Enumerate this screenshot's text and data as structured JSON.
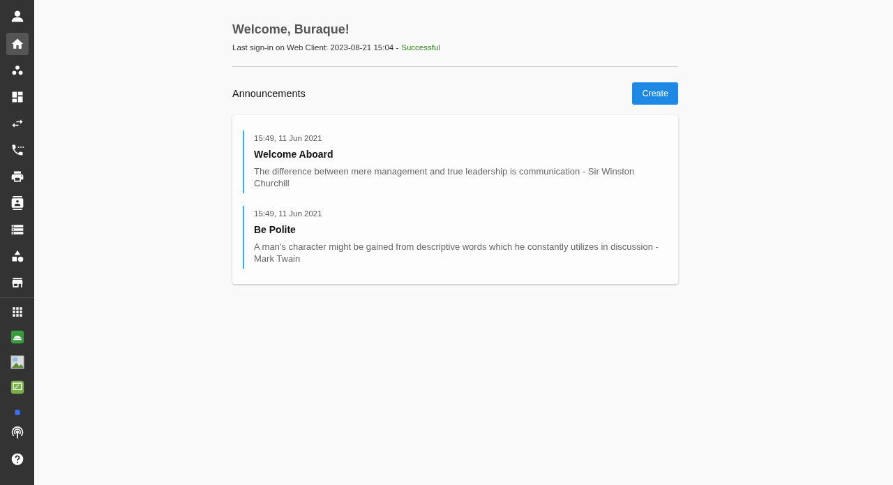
{
  "sidebar": {
    "top": [
      {
        "kind": "user",
        "selected": false
      }
    ],
    "upper": [
      {
        "kind": "home",
        "selected": true
      },
      {
        "kind": "groups",
        "selected": false
      },
      {
        "kind": "dashboard",
        "selected": false
      },
      {
        "kind": "swap",
        "selected": false
      },
      {
        "kind": "phone",
        "selected": false
      },
      {
        "kind": "printer",
        "selected": false
      },
      {
        "kind": "contact",
        "selected": false
      },
      {
        "kind": "list",
        "selected": false
      },
      {
        "kind": "shapes",
        "selected": false
      },
      {
        "kind": "store",
        "selected": false
      }
    ],
    "lower": [
      {
        "kind": "apps",
        "selected": false
      },
      {
        "kind": "tile-green",
        "selected": false
      },
      {
        "kind": "image",
        "selected": false
      },
      {
        "kind": "tile-picture",
        "selected": false
      },
      {
        "kind": "tile-blue",
        "selected": false
      }
    ],
    "bottom": [
      {
        "kind": "broadcast",
        "selected": false
      },
      {
        "kind": "help",
        "selected": false
      }
    ]
  },
  "welcome": {
    "title": "Welcome, Buraque!",
    "last_sign_in": "Last sign-in on Web Client: 2023-08-21 15:04 -",
    "status": "Successful"
  },
  "announcements": {
    "title": "Announcements",
    "create_button": "Create",
    "items": [
      {
        "time": "15:49, 11 Jun 2021",
        "title": "Welcome Aboard",
        "body": "The difference between mere management and true leadership is communication - Sir Winston Churchill"
      },
      {
        "time": "15:49, 11 Jun 2021",
        "title": "Be Polite",
        "body": "A man's character might be gained from descriptive words which he constantly utilizes in discussion - Mark Twain"
      }
    ]
  }
}
